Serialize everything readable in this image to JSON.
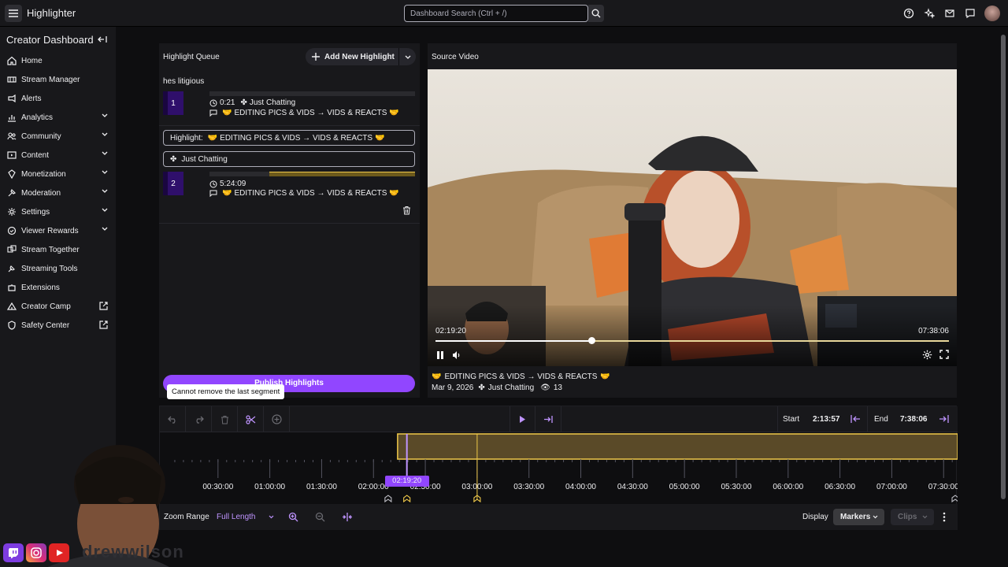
{
  "app": {
    "title": "Highlighter"
  },
  "search": {
    "placeholder": "Dashboard Search (Ctrl + /)"
  },
  "sidebar": {
    "title": "Creator Dashboard",
    "items": [
      {
        "label": "Home",
        "icon": "home-icon",
        "chevron": false,
        "external": false
      },
      {
        "label": "Stream Manager",
        "icon": "stream-manager-icon",
        "chevron": false,
        "external": false
      },
      {
        "label": "Alerts",
        "icon": "alerts-icon",
        "chevron": false,
        "external": false
      },
      {
        "label": "Analytics",
        "icon": "analytics-icon",
        "chevron": true,
        "external": false
      },
      {
        "label": "Community",
        "icon": "community-icon",
        "chevron": true,
        "external": false
      },
      {
        "label": "Content",
        "icon": "content-icon",
        "chevron": true,
        "external": false
      },
      {
        "label": "Monetization",
        "icon": "monetization-icon",
        "chevron": true,
        "external": false
      },
      {
        "label": "Moderation",
        "icon": "moderation-icon",
        "chevron": true,
        "external": false
      },
      {
        "label": "Settings",
        "icon": "settings-icon",
        "chevron": true,
        "external": false
      },
      {
        "label": "Viewer Rewards",
        "icon": "viewer-rewards-icon",
        "chevron": true,
        "external": false
      },
      {
        "label": "Stream Together",
        "icon": "stream-together-icon",
        "chevron": false,
        "external": false
      },
      {
        "label": "Streaming Tools",
        "icon": "streaming-tools-icon",
        "chevron": false,
        "external": false
      },
      {
        "label": "Extensions",
        "icon": "extensions-icon",
        "chevron": false,
        "external": false
      },
      {
        "label": "Creator Camp",
        "icon": "creator-camp-icon",
        "chevron": false,
        "external": true
      },
      {
        "label": "Safety Center",
        "icon": "safety-center-icon",
        "chevron": false,
        "external": true
      }
    ]
  },
  "queue": {
    "title": "Highlight Queue",
    "add_label": "Add New Highlight",
    "highlight_name": "hes litigious",
    "segments": [
      {
        "number": "1",
        "duration": "0:21",
        "category": "Just Chatting",
        "title": "EDITING PICS & VIDS → VIDS & REACTS"
      },
      {
        "number": "2",
        "duration": "5:24:09",
        "category": "",
        "title": "EDITING PICS & VIDS → VIDS & REACTS"
      }
    ],
    "title_field_label": "Highlight:",
    "title_field_value": "EDITING PICS & VIDS → VIDS & REACTS",
    "category_field": "Just Chatting",
    "publish_label": "Publish Highlights",
    "tooltip": "Cannot remove the last segment"
  },
  "source": {
    "title": "Source Video",
    "current_time": "02:19:20",
    "total_time": "07:38:06",
    "progress": 0.304,
    "stream_title": "EDITING PICS & VIDS → VIDS & REACTS",
    "date": "Mar 9, 2026",
    "category": "Just Chatting",
    "views": "13"
  },
  "editor": {
    "start_label": "Start",
    "start_value": "2:13:57",
    "end_label": "End",
    "end_value": "7:38:06",
    "ticks": [
      "00:30:00",
      "01:00:00",
      "01:30:00",
      "02:00:00",
      "02:30:00",
      "03:00:00",
      "03:30:00",
      "04:00:00",
      "04:30:00",
      "05:00:00",
      "05:30:00",
      "06:00:00",
      "06:30:00",
      "07:00:00",
      "07:30:00"
    ],
    "playhead_time": "02:19:20",
    "zoom_label": "Zoom Range",
    "zoom_value": "Full Length",
    "display_label": "Display",
    "display_markers": "Markers",
    "display_clips": "Clips"
  },
  "colors": {
    "accent": "#9146ff",
    "segment": "#f0c94a",
    "panel": "#18181b",
    "background": "#0e0e10"
  },
  "watermark": "drewwilson"
}
